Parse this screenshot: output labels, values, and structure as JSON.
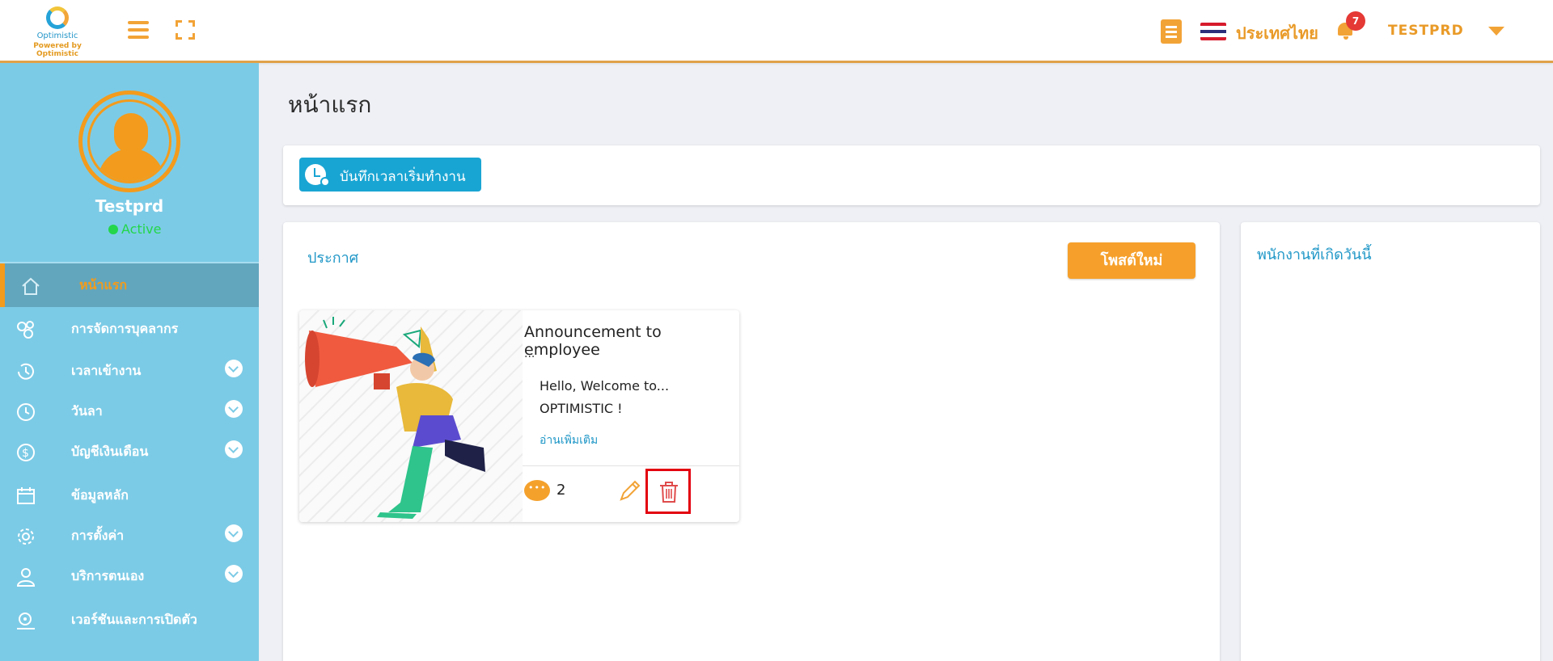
{
  "header": {
    "logo_name": "Optimistic",
    "logo_tagline": "Powered by Optimistic",
    "country": "ประเทศไทย",
    "notification_count": "7",
    "username": "TESTPRD"
  },
  "profile": {
    "name": "Testprd",
    "status": "Active"
  },
  "sidebar": {
    "items": [
      {
        "label": "หน้าแรก",
        "icon": "home-icon",
        "active": true
      },
      {
        "label": "การจัดการบุคลากร",
        "icon": "people-gears-icon",
        "active": false
      },
      {
        "label": "เวลาเข้างาน",
        "icon": "clock-history-icon",
        "active": false
      },
      {
        "label": "วันลา",
        "icon": "clock-icon",
        "active": false
      },
      {
        "label": "บัญชีเงินเดือน",
        "icon": "dollar-icon",
        "active": false
      },
      {
        "label": "ข้อมูลหลัก",
        "icon": "calendar-icon",
        "active": false
      },
      {
        "label": "การตั้งค่า",
        "icon": "gear-icon",
        "active": false
      },
      {
        "label": "บริการตนเอง",
        "icon": "user-icon",
        "active": false
      },
      {
        "label": "เวอร์ชันและการเปิดตัว",
        "icon": "release-icon",
        "active": false
      }
    ]
  },
  "main": {
    "page_title": "หน้าแรก",
    "clock_in_label": "บันทึกเวลาเริ่มทำงาน",
    "announcements": {
      "title": "ประกาศ",
      "new_post_label": "โพสต์ใหม่",
      "post": {
        "title": "Announcement to employee",
        "ellipsis": "...",
        "body_line1": "Hello, Welcome to...",
        "body_line2": "OPTIMISTIC !",
        "read_more": "อ่านเพิ่มเติม",
        "comment_count": "2"
      }
    },
    "birthday_title": "พนักงานที่เกิดวันนี้"
  },
  "colors": {
    "accent": "#f39b1c",
    "sidebar": "#7ccbe6",
    "primary_blue": "#19a5d3",
    "highlight_red": "#e3000f"
  }
}
